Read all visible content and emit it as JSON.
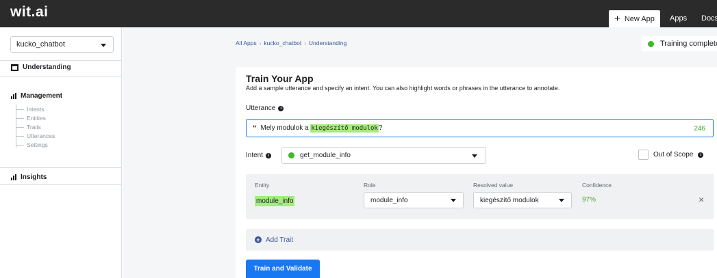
{
  "topbar": {
    "logo": "wit.ai",
    "new_app": "New App",
    "apps": "Apps",
    "docs": "Docs"
  },
  "sidebar": {
    "app_name": "kucko_chatbot",
    "understanding": "Understanding",
    "management": "Management",
    "management_items": [
      "Intents",
      "Entities",
      "Traits",
      "Utterances",
      "Settings"
    ],
    "insights": "Insights"
  },
  "breadcrumb": [
    "All Apps",
    "kucko_chatbot",
    "Understanding"
  ],
  "status": {
    "text": "Training complete",
    "color": "#42b72a"
  },
  "train": {
    "title": "Train Your App",
    "subtitle": "Add a sample utterance and specify an intent. You can also highlight words or phrases in the utterance to annotate.",
    "utterance_label": "Utterance",
    "utterance_before": "Mely modulok a ",
    "utterance_highlight": "kiegészítő modulok",
    "utterance_after": "?",
    "char_count": "246",
    "intent_label": "Intent",
    "intent_value": "get_module_info",
    "out_of_scope": "Out of Scope",
    "entity_headers": {
      "entity": "Entity",
      "role": "Role",
      "resolved": "Resolved value",
      "confidence": "Confidence"
    },
    "entity_row": {
      "entity": "module_info",
      "role": "module_info",
      "resolved": "kiegészítő modulok",
      "confidence": "97%"
    },
    "add_trait": "Add Trait",
    "train_button": "Train and Validate"
  },
  "colors": {
    "topbar": "#2b2b2b",
    "accent": "#1877f2",
    "highlight": "#a5ec7c",
    "success": "#42b72a"
  }
}
